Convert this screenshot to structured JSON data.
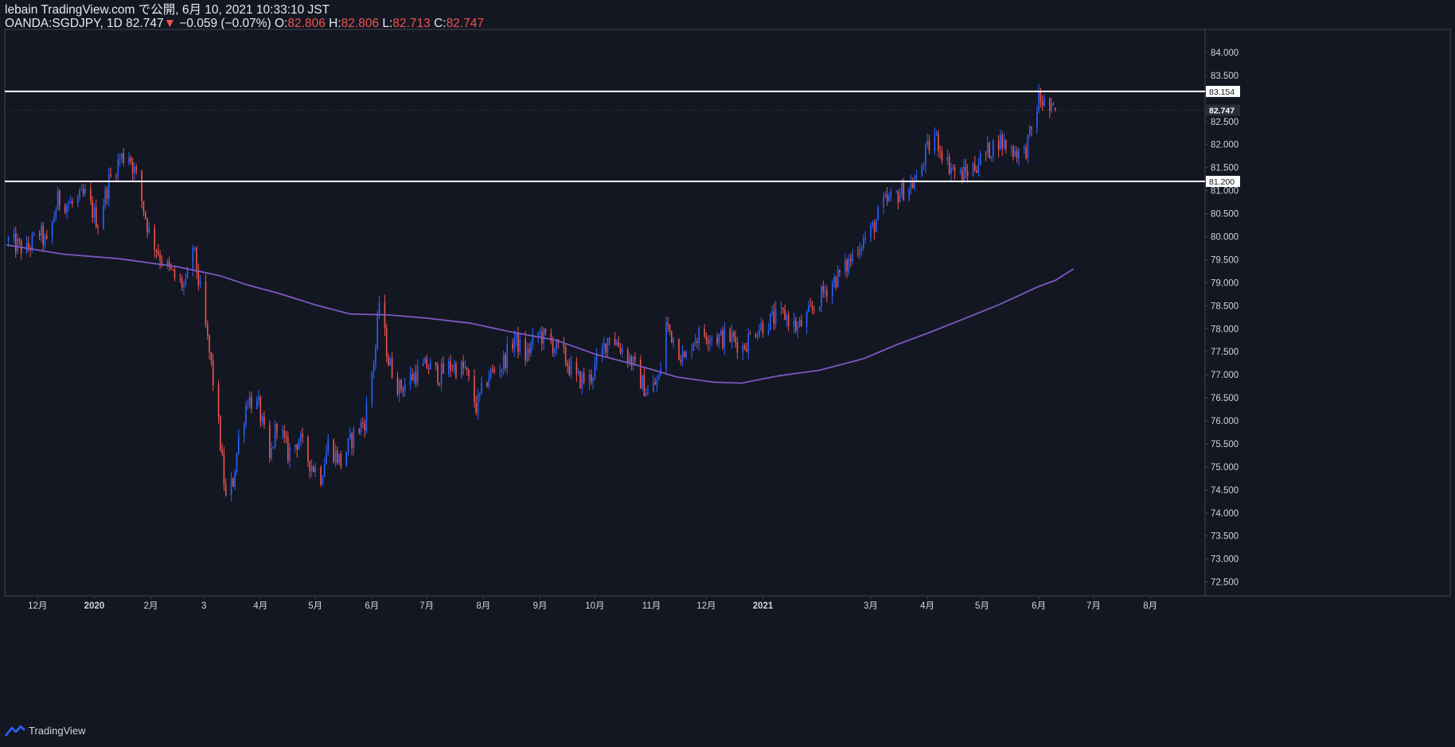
{
  "header": {
    "published_line": "lebain TradingView.com で公開, 6月 10, 2021 10:33:10 JST",
    "symbol": "OANDA:SGDJPY, 1D 82.747",
    "change_arrow": "▼",
    "change": "−0.059 (−0.07%)",
    "o_label": "O:",
    "o_value": "82.806",
    "h_label": "H:",
    "h_value": "82.806",
    "l_label": "L:",
    "l_value": "82.713",
    "c_label": "C:",
    "c_value": "82.747"
  },
  "footer": {
    "brand": "TradingView",
    "logo_icon": "tradingview-logo-icon"
  },
  "colors": {
    "background": "#131722",
    "up": "#2962ff",
    "down": "#ef5350",
    "ma": "#7e57c2",
    "level_line": "#ffffff",
    "axis_text": "#d1d4dc",
    "grid": "#1c2030",
    "border": "#434651"
  },
  "chart_data": {
    "type": "candlestick",
    "symbol": "OANDA:SGDJPY",
    "interval": "1D",
    "grid": false,
    "ylim": [
      72.2,
      84.5
    ],
    "y_ticks": [
      72.5,
      73.0,
      73.5,
      74.0,
      74.5,
      75.0,
      75.5,
      76.0,
      76.5,
      77.0,
      77.5,
      78.0,
      78.5,
      79.0,
      79.5,
      80.0,
      80.5,
      81.0,
      81.5,
      82.0,
      82.5,
      83.0,
      83.5,
      84.0
    ],
    "y_tick_labels": [
      "72.500",
      "73.000",
      "73.500",
      "74.000",
      "74.500",
      "75.000",
      "75.500",
      "76.000",
      "76.500",
      "77.000",
      "77.500",
      "78.000",
      "78.500",
      "79.000",
      "79.500",
      "80.000",
      "80.500",
      "81.000",
      "81.500",
      "82.000",
      "82.500",
      "83.000",
      "83.500",
      "84.000"
    ],
    "x_labels": [
      {
        "date": "2019-12-01",
        "label": "12月"
      },
      {
        "date": "2020-01-01",
        "label": "2020"
      },
      {
        "date": "2020-02-01",
        "label": "2月"
      },
      {
        "date": "2020-03-01",
        "label": "3"
      },
      {
        "date": "2020-04-01",
        "label": "4月"
      },
      {
        "date": "2020-05-01",
        "label": "5月"
      },
      {
        "date": "2020-06-01",
        "label": "6月"
      },
      {
        "date": "2020-07-01",
        "label": "7月"
      },
      {
        "date": "2020-08-01",
        "label": "8月"
      },
      {
        "date": "2020-09-01",
        "label": "9月"
      },
      {
        "date": "2020-10-01",
        "label": "10月"
      },
      {
        "date": "2020-11-01",
        "label": "11月"
      },
      {
        "date": "2020-12-01",
        "label": "12月"
      },
      {
        "date": "2021-01-01",
        "label": "2021"
      },
      {
        "date": "2021-03-01",
        "label": "3月"
      },
      {
        "date": "2021-04-01",
        "label": "4月"
      },
      {
        "date": "2021-05-01",
        "label": "5月"
      },
      {
        "date": "2021-06-01",
        "label": "6月"
      },
      {
        "date": "2021-07-01",
        "label": "7月"
      },
      {
        "date": "2021-08-01",
        "label": "8月"
      }
    ],
    "x_range": [
      "2019-11-13",
      "2021-08-31"
    ],
    "horizontal_levels": [
      {
        "value": 83.154,
        "label": "83.154"
      },
      {
        "value": 81.2,
        "label": "81.200"
      }
    ],
    "last_price": {
      "value": 82.747,
      "label": "82.747"
    },
    "close_path": [
      [
        "2019-11-15",
        79.9
      ],
      [
        "2019-11-25",
        79.7
      ],
      [
        "2019-12-02",
        80.1
      ],
      [
        "2019-12-06",
        79.8
      ],
      [
        "2019-12-12",
        80.8
      ],
      [
        "2019-12-20",
        80.7
      ],
      [
        "2019-12-27",
        80.9
      ],
      [
        "2020-01-03",
        80.3
      ],
      [
        "2020-01-09",
        81.2
      ],
      [
        "2020-01-15",
        81.7
      ],
      [
        "2020-01-20",
        81.8
      ],
      [
        "2020-01-24",
        81.3
      ],
      [
        "2020-01-31",
        80.1
      ],
      [
        "2020-02-07",
        79.5
      ],
      [
        "2020-02-14",
        79.1
      ],
      [
        "2020-02-20",
        78.9
      ],
      [
        "2020-02-24",
        79.8
      ],
      [
        "2020-02-28",
        78.8
      ],
      [
        "2020-03-05",
        77.2
      ],
      [
        "2020-03-09",
        75.9
      ],
      [
        "2020-03-13",
        74.3
      ],
      [
        "2020-03-17",
        74.7
      ],
      [
        "2020-03-20",
        75.6
      ],
      [
        "2020-03-25",
        76.5
      ],
      [
        "2020-03-31",
        76.3
      ],
      [
        "2020-04-06",
        75.1
      ],
      [
        "2020-04-10",
        76.0
      ],
      [
        "2020-04-16",
        75.3
      ],
      [
        "2020-04-22",
        75.6
      ],
      [
        "2020-04-28",
        75.1
      ],
      [
        "2020-05-04",
        74.8
      ],
      [
        "2020-05-08",
        75.5
      ],
      [
        "2020-05-15",
        75.1
      ],
      [
        "2020-05-22",
        75.7
      ],
      [
        "2020-05-28",
        76.0
      ],
      [
        "2020-06-03",
        77.6
      ],
      [
        "2020-06-05",
        78.6
      ],
      [
        "2020-06-10",
        77.3
      ],
      [
        "2020-06-16",
        76.7
      ],
      [
        "2020-06-24",
        77.0
      ],
      [
        "2020-07-01",
        77.2
      ],
      [
        "2020-07-08",
        77.0
      ],
      [
        "2020-07-14",
        77.2
      ],
      [
        "2020-07-22",
        77.1
      ],
      [
        "2020-07-28",
        76.3
      ],
      [
        "2020-08-04",
        77.0
      ],
      [
        "2020-08-11",
        77.2
      ],
      [
        "2020-08-18",
        77.8
      ],
      [
        "2020-08-24",
        77.4
      ],
      [
        "2020-08-31",
        77.9
      ],
      [
        "2020-09-07",
        77.7
      ],
      [
        "2020-09-14",
        77.4
      ],
      [
        "2020-09-21",
        76.9
      ],
      [
        "2020-09-28",
        76.9
      ],
      [
        "2020-10-05",
        77.5
      ],
      [
        "2020-10-09",
        77.9
      ],
      [
        "2020-10-15",
        77.6
      ],
      [
        "2020-10-21",
        77.3
      ],
      [
        "2020-10-27",
        76.8
      ],
      [
        "2020-10-30",
        76.6
      ],
      [
        "2020-11-05",
        76.9
      ],
      [
        "2020-11-09",
        78.1
      ],
      [
        "2020-11-13",
        77.8
      ],
      [
        "2020-11-19",
        77.3
      ],
      [
        "2020-11-24",
        77.8
      ],
      [
        "2020-12-01",
        77.9
      ],
      [
        "2020-12-08",
        77.8
      ],
      [
        "2020-12-15",
        77.8
      ],
      [
        "2020-12-21",
        77.6
      ],
      [
        "2020-12-28",
        78.0
      ],
      [
        "2021-01-06",
        78.2
      ],
      [
        "2021-01-13",
        78.3
      ],
      [
        "2021-01-20",
        78.0
      ],
      [
        "2021-01-28",
        78.4
      ],
      [
        "2021-02-05",
        78.9
      ],
      [
        "2021-02-15",
        79.3
      ],
      [
        "2021-02-22",
        79.8
      ],
      [
        "2021-03-01",
        80.1
      ],
      [
        "2021-03-08",
        80.7
      ],
      [
        "2021-03-15",
        80.9
      ],
      [
        "2021-03-22",
        81.1
      ],
      [
        "2021-03-26",
        81.2
      ],
      [
        "2021-03-31",
        81.8
      ],
      [
        "2021-04-05",
        82.2
      ],
      [
        "2021-04-12",
        81.6
      ],
      [
        "2021-04-19",
        81.3
      ],
      [
        "2021-04-26",
        81.5
      ],
      [
        "2021-05-03",
        81.8
      ],
      [
        "2021-05-10",
        82.1
      ],
      [
        "2021-05-17",
        81.9
      ],
      [
        "2021-05-24",
        81.8
      ],
      [
        "2021-05-28",
        82.3
      ],
      [
        "2021-06-01",
        83.0
      ],
      [
        "2021-06-04",
        82.9
      ],
      [
        "2021-06-08",
        82.7
      ],
      [
        "2021-06-10",
        82.747
      ]
    ],
    "series": [
      {
        "type": "line",
        "points": [
          [
            "2019-11-14",
            79.82
          ],
          [
            "2019-12-15",
            79.62
          ],
          [
            "2020-01-15",
            79.52
          ],
          [
            "2020-02-15",
            79.35
          ],
          [
            "2020-03-10",
            79.15
          ],
          [
            "2020-03-25",
            78.95
          ],
          [
            "2020-04-10",
            78.78
          ],
          [
            "2020-05-01",
            78.52
          ],
          [
            "2020-05-20",
            78.32
          ],
          [
            "2020-06-10",
            78.3
          ],
          [
            "2020-07-01",
            78.23
          ],
          [
            "2020-07-25",
            78.12
          ],
          [
            "2020-08-15",
            77.94
          ],
          [
            "2020-09-10",
            77.75
          ],
          [
            "2020-10-01",
            77.45
          ],
          [
            "2020-10-25",
            77.2
          ],
          [
            "2020-11-15",
            76.95
          ],
          [
            "2020-12-05",
            76.84
          ],
          [
            "2020-12-20",
            76.82
          ],
          [
            "2021-01-10",
            76.98
          ],
          [
            "2021-02-01",
            77.1
          ],
          [
            "2021-02-25",
            77.35
          ],
          [
            "2021-03-15",
            77.65
          ],
          [
            "2021-04-01",
            77.9
          ],
          [
            "2021-04-20",
            78.2
          ],
          [
            "2021-05-10",
            78.52
          ],
          [
            "2021-06-01",
            78.92
          ],
          [
            "2021-06-10",
            79.05
          ],
          [
            "2021-06-20",
            79.3
          ]
        ]
      }
    ]
  }
}
